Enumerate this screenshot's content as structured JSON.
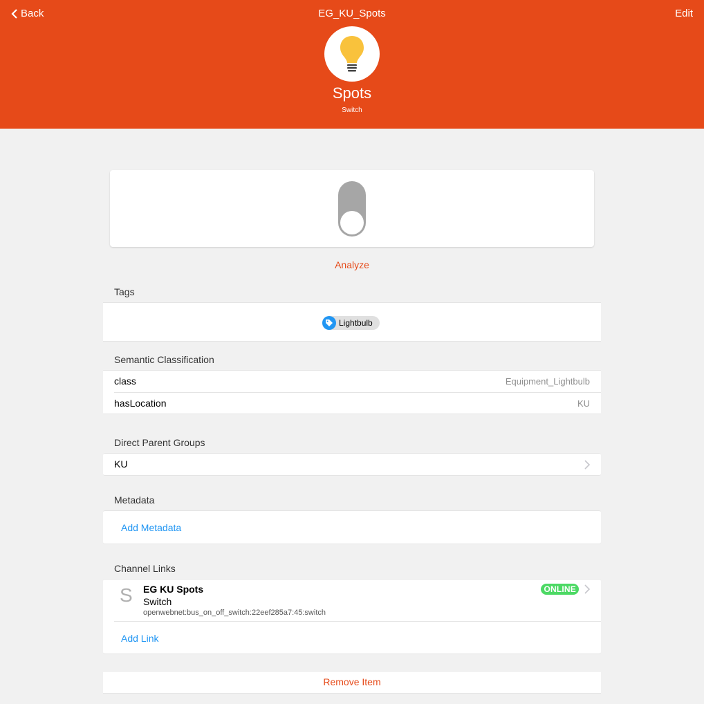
{
  "navbar": {
    "back_label": "Back",
    "title": "EG_KU_Spots",
    "edit_label": "Edit"
  },
  "item": {
    "icon": "lightbulb-icon",
    "label": "Spots",
    "type": "Switch",
    "state": "OFF"
  },
  "analyze_label": "Analyze",
  "tags": {
    "title": "Tags",
    "items": [
      "Lightbulb"
    ]
  },
  "semantic": {
    "title": "Semantic Classification",
    "rows": [
      {
        "key": "class",
        "value": "Equipment_Lightbulb"
      },
      {
        "key": "hasLocation",
        "value": "KU"
      }
    ]
  },
  "parents": {
    "title": "Direct Parent Groups",
    "items": [
      "KU"
    ]
  },
  "metadata": {
    "title": "Metadata",
    "add_label": "Add Metadata"
  },
  "channel_links": {
    "title": "Channel Links",
    "items": [
      {
        "avatar": "S",
        "name": "EG KU Spots",
        "type": "Switch",
        "uid": "openwebnet:bus_on_off_switch:22eef285a7:45:switch",
        "status": "ONLINE"
      }
    ],
    "add_label": "Add Link"
  },
  "remove_label": "Remove Item",
  "colors": {
    "accent": "#e64a19",
    "link": "#2196f3",
    "online": "#4cd964",
    "toggle_off": "#a6a6a6"
  }
}
